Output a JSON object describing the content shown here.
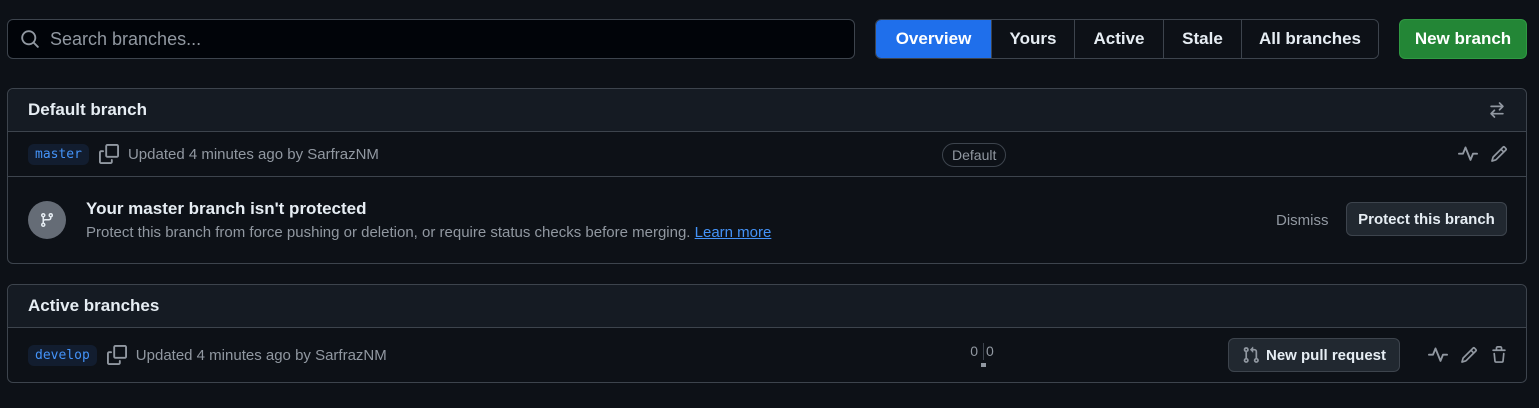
{
  "search": {
    "placeholder": "Search branches..."
  },
  "tabs": [
    {
      "label": "Overview",
      "selected": true
    },
    {
      "label": "Yours",
      "selected": false
    },
    {
      "label": "Active",
      "selected": false
    },
    {
      "label": "Stale",
      "selected": false
    },
    {
      "label": "All branches",
      "selected": false
    }
  ],
  "new_branch_label": "New branch",
  "default_section": {
    "title": "Default branch",
    "branch": {
      "name": "master",
      "updated": "Updated 4 minutes ago by SarfrazNM",
      "badge": "Default"
    },
    "notice": {
      "title": "Your master branch isn't protected",
      "description": "Protect this branch from force pushing or deletion, or require status checks before merging.",
      "learn_more": "Learn more",
      "dismiss": "Dismiss",
      "protect_button": "Protect this branch"
    }
  },
  "active_section": {
    "title": "Active branches",
    "branches": [
      {
        "name": "develop",
        "updated": "Updated 4 minutes ago by SarfrazNM",
        "behind": "0",
        "ahead": "0",
        "new_pr_label": "New pull request"
      }
    ]
  },
  "colors": {
    "background": "#0d1117",
    "accent_blue": "#1f6feb",
    "primary_green": "#238636",
    "link": "#4493f8",
    "muted_text": "#9198a1",
    "border": "#3d444d"
  },
  "icons": [
    "search-icon",
    "switch-arrows-icon",
    "copy-icon",
    "activity-icon",
    "pencil-icon",
    "git-branch-icon",
    "git-pull-request-icon",
    "trash-icon"
  ]
}
